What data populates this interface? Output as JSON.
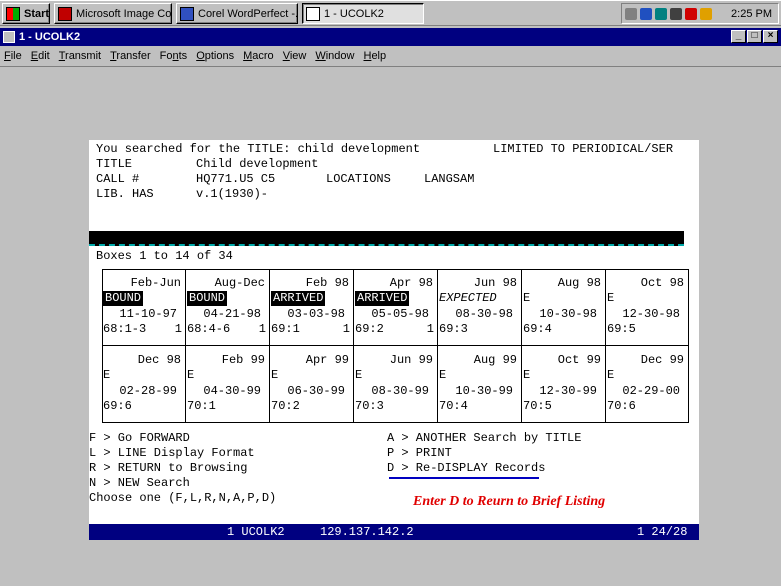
{
  "taskbar": {
    "start_label": "Start",
    "buttons": [
      {
        "label": "Microsoft Image Co...",
        "pressed": false
      },
      {
        "label": "Corel WordPerfect -...",
        "pressed": false
      },
      {
        "label": "1 - UCOLK2",
        "pressed": true
      }
    ],
    "clock": "2:25 PM"
  },
  "window": {
    "title": "1 - UCOLK2",
    "menu": [
      {
        "label": "File",
        "u": "F",
        "rest": "ile"
      },
      {
        "label": "Edit",
        "u": "E",
        "rest": "dit"
      },
      {
        "label": "Transmit",
        "u": "T",
        "rest": "ransmit"
      },
      {
        "label": "Transfer",
        "u": "T",
        "rest": "ransfer"
      },
      {
        "label": "Fonts",
        "pre": "Fo",
        "u": "n",
        "rest": "ts"
      },
      {
        "label": "Options",
        "u": "O",
        "rest": "ptions"
      },
      {
        "label": "Macro",
        "u": "M",
        "rest": "acro"
      },
      {
        "label": "View",
        "u": "V",
        "rest": "iew"
      },
      {
        "label": "Window",
        "u": "W",
        "rest": "indow"
      },
      {
        "label": "Help",
        "u": "H",
        "rest": "elp"
      }
    ]
  },
  "terminal": {
    "header_line": "You searched for the TITLE: child development",
    "limit_note": "LIMITED TO PERIODICAL/SER",
    "title_label": "TITLE",
    "title_value": "Child development",
    "call_label": "CALL #",
    "call_value": "HQ771.U5 C5",
    "locations_label": "LOCATIONS",
    "locations_value": "LANGSAM",
    "libhas_label": "LIB. HAS",
    "libhas_value": "v.1(1930)-",
    "boxes_range": "Boxes 1 to 14 of 34",
    "boxes": [
      {
        "date": "Feb-Jun",
        "status": "BOUND",
        "style": "inv",
        "recv": "11-10-97",
        "vol": "68:1-3",
        "count": "1"
      },
      {
        "date": "Aug-Dec",
        "status": "BOUND",
        "style": "inv",
        "recv": "04-21-98",
        "vol": "68:4-6",
        "count": "1"
      },
      {
        "date": "Feb 98",
        "status": "ARRIVED",
        "style": "inv",
        "recv": "03-03-98",
        "vol": "69:1",
        "count": "1"
      },
      {
        "date": "Apr 98",
        "status": "ARRIVED",
        "style": "inv",
        "recv": "05-05-98",
        "vol": "69:2",
        "count": "1"
      },
      {
        "date": "Jun 98",
        "status": "EXPECTED",
        "style": "it",
        "recv": "08-30-98",
        "vol": "69:3",
        "count": ""
      },
      {
        "date": "Aug 98",
        "status": "E",
        "style": "",
        "recv": "10-30-98",
        "vol": "69:4",
        "count": ""
      },
      {
        "date": "Oct 98",
        "status": "E",
        "style": "",
        "recv": "12-30-98",
        "vol": "69:5",
        "count": ""
      },
      {
        "date": "Dec 98",
        "status": "E",
        "style": "",
        "recv": "02-28-99",
        "vol": "69:6",
        "count": ""
      },
      {
        "date": "Feb 99",
        "status": "E",
        "style": "",
        "recv": "04-30-99",
        "vol": "70:1",
        "count": ""
      },
      {
        "date": "Apr 99",
        "status": "E",
        "style": "",
        "recv": "06-30-99",
        "vol": "70:2",
        "count": ""
      },
      {
        "date": "Jun 99",
        "status": "E",
        "style": "",
        "recv": "08-30-99",
        "vol": "70:3",
        "count": ""
      },
      {
        "date": "Aug 99",
        "status": "E",
        "style": "",
        "recv": "10-30-99",
        "vol": "70:4",
        "count": ""
      },
      {
        "date": "Oct 99",
        "status": "E",
        "style": "",
        "recv": "12-30-99",
        "vol": "70:5",
        "count": ""
      },
      {
        "date": "Dec 99",
        "status": "E",
        "style": "",
        "recv": "02-29-00",
        "vol": "70:6",
        "count": ""
      }
    ],
    "options_left": [
      "F > Go FORWARD",
      "L > LINE Display Format",
      "R > RETURN to Browsing",
      "N > NEW Search",
      "Choose one (F,L,R,N,A,P,D)"
    ],
    "options_right": [
      "A > ANOTHER Search by TITLE",
      "P > PRINT",
      "D > Re-DISPLAY Records"
    ],
    "instruction": "Enter D to Reurn to Brief Listing",
    "status_session": "1 UCOLK2",
    "status_ip": "129.137.142.2",
    "status_pos": "1 24/28"
  },
  "colors": {
    "titlebar": "#000080",
    "instruction": "#e00000",
    "underline": "#0000c0"
  }
}
